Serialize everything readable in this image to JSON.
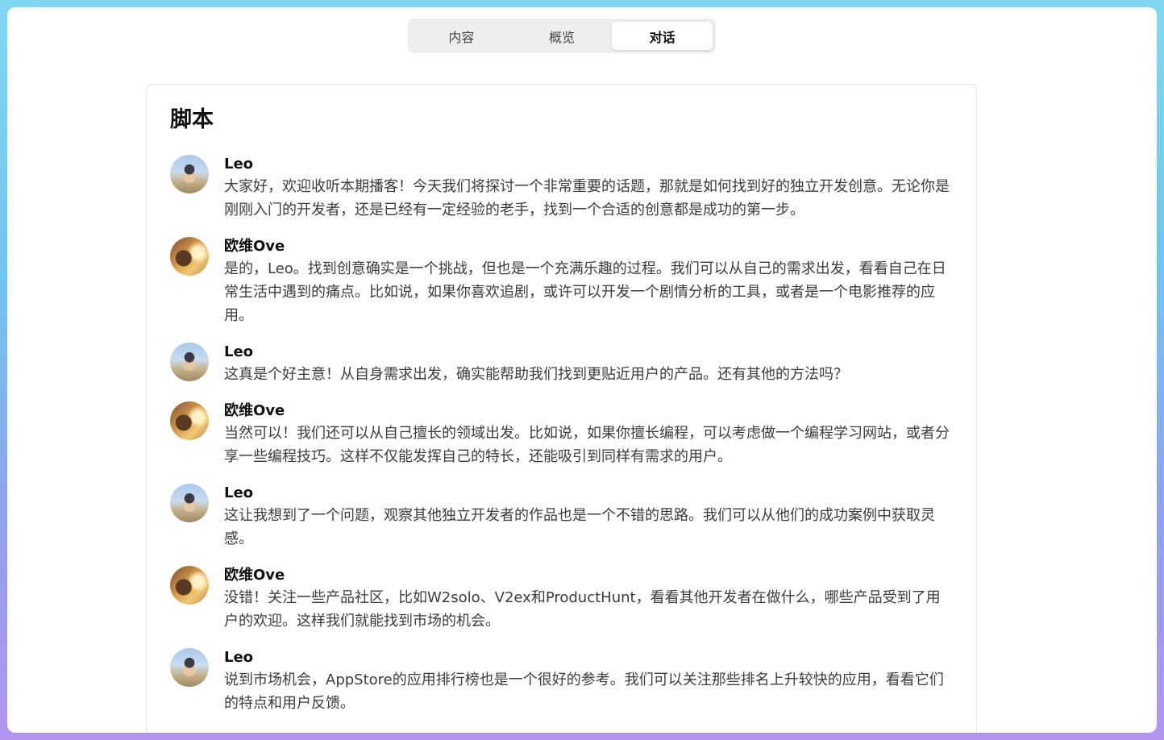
{
  "tabs": [
    {
      "label": "内容",
      "active": false
    },
    {
      "label": "概览",
      "active": false
    },
    {
      "label": "对话",
      "active": true
    }
  ],
  "script": {
    "title": "脚本",
    "messages": [
      {
        "speaker": "Leo",
        "avatar": "leo-avatar",
        "text": "大家好，欢迎收听本期播客！今天我们将探讨一个非常重要的话题，那就是如何找到好的独立开发创意。无论你是刚刚入门的开发者，还是已经有一定经验的老手，找到一个合适的创意都是成功的第一步。"
      },
      {
        "speaker": "欧维Ove",
        "avatar": "ove-avatar",
        "text": "是的，Leo。找到创意确实是一个挑战，但也是一个充满乐趣的过程。我们可以从自己的需求出发，看看自己在日常生活中遇到的痛点。比如说，如果你喜欢追剧，或许可以开发一个剧情分析的工具，或者是一个电影推荐的应用。"
      },
      {
        "speaker": "Leo",
        "avatar": "leo-avatar",
        "text": "这真是个好主意！从自身需求出发，确实能帮助我们找到更贴近用户的产品。还有其他的方法吗？"
      },
      {
        "speaker": "欧维Ove",
        "avatar": "ove-avatar",
        "text": "当然可以！我们还可以从自己擅长的领域出发。比如说，如果你擅长编程，可以考虑做一个编程学习网站，或者分享一些编程技巧。这样不仅能发挥自己的特长，还能吸引到同样有需求的用户。"
      },
      {
        "speaker": "Leo",
        "avatar": "leo-avatar",
        "text": "这让我想到了一个问题，观察其他独立开发者的作品也是一个不错的思路。我们可以从他们的成功案例中获取灵感。"
      },
      {
        "speaker": "欧维Ove",
        "avatar": "ove-avatar",
        "text": "没错！关注一些产品社区，比如W2solo、V2ex和ProductHunt，看看其他开发者在做什么，哪些产品受到了用户的欢迎。这样我们就能找到市场的机会。"
      },
      {
        "speaker": "Leo",
        "avatar": "leo-avatar",
        "text": "说到市场机会，AppStore的应用排行榜也是一个很好的参考。我们可以关注那些排名上升较快的应用，看看它们的特点和用户反馈。"
      }
    ]
  }
}
